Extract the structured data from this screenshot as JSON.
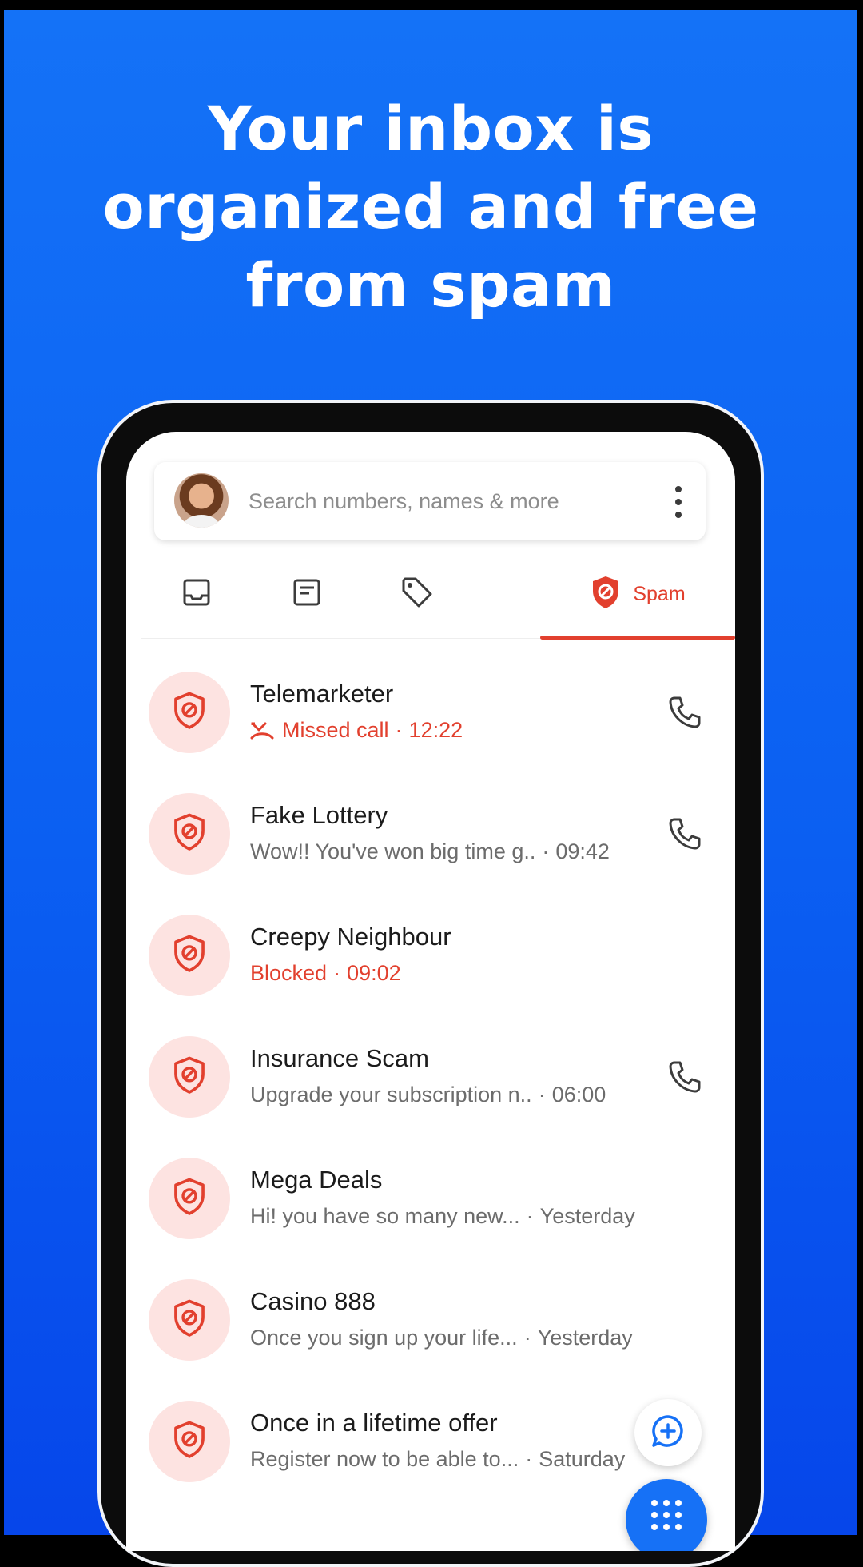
{
  "headline": {
    "line1": "Your inbox is",
    "line2": "organized and free",
    "line3": "from spam"
  },
  "search": {
    "placeholder": "Search numbers, names & more"
  },
  "tabs": [
    {
      "icon": "inbox-icon",
      "label": ""
    },
    {
      "icon": "message-icon",
      "label": ""
    },
    {
      "icon": "tag-icon",
      "label": ""
    },
    {
      "icon": "spam-shield-icon",
      "label": "Spam",
      "active": true
    }
  ],
  "rows": [
    {
      "title": "Telemarketer",
      "subtitle": "Missed call",
      "time": "12:22",
      "status": "missed",
      "has_call": true
    },
    {
      "title": "Fake Lottery",
      "subtitle": "Wow!! You've won big time g..",
      "time": "09:42",
      "status": "normal",
      "has_call": true
    },
    {
      "title": "Creepy Neighbour",
      "subtitle": "Blocked",
      "time": "09:02",
      "status": "blocked",
      "has_call": false
    },
    {
      "title": "Insurance Scam",
      "subtitle": "Upgrade your subscription n..",
      "time": "06:00",
      "status": "normal",
      "has_call": true
    },
    {
      "title": "Mega Deals",
      "subtitle": "Hi! you have so many new...",
      "time": "Yesterday",
      "status": "normal",
      "has_call": false
    },
    {
      "title": "Casino 888",
      "subtitle": "Once you sign up your life...",
      "time": "Yesterday",
      "status": "normal",
      "has_call": false
    },
    {
      "title": "Once in a lifetime offer",
      "subtitle": "Register now to be able to...",
      "time": "Saturday",
      "status": "normal",
      "has_call": false
    }
  ],
  "separator": "·",
  "colors": {
    "background_top": "#1472f7",
    "background_bottom": "#0646ea",
    "accent_red": "#e2402e",
    "spam_avatar_bg": "#fde3e1",
    "fab_blue": "#1671f6"
  }
}
